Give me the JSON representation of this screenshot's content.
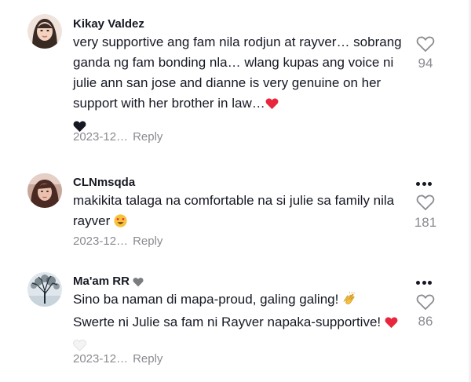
{
  "comments": [
    {
      "author": "Kikay Valdez",
      "text": "very supportive ang fam nila rodjun at rayver… sobrang ganda ng fam bonding nla… wlang kupas ang voice ni julie ann san jose and dianne is very genuine on her support with her brother in law…",
      "date": "2023-12…",
      "reply_label": "Reply",
      "likes": "94"
    },
    {
      "author": "CLNmsqda",
      "text": "makikita talaga na comfortable na si julie sa family nila rayver",
      "date": "2023-12…",
      "reply_label": "Reply",
      "likes": "181"
    },
    {
      "author": "Ma'am RR",
      "text": "Sino ba naman di mapa-proud, galing galing!",
      "text2": "Swerte ni Julie sa fam ni Rayver napaka-supportive!",
      "date": "2023-12…",
      "reply_label": "Reply",
      "likes": "86"
    }
  ],
  "colors": {
    "text": "#161823",
    "muted": "#8a8b91",
    "heart_red": "#e8273c"
  },
  "icons": [
    "heart-outline-icon",
    "more-options-icon",
    "red-heart-emoji",
    "black-heart-emoji",
    "heart-eyes-emoji",
    "clapping-hands-emoji",
    "grey-heart-emoji",
    "white-heart-emoji"
  ]
}
